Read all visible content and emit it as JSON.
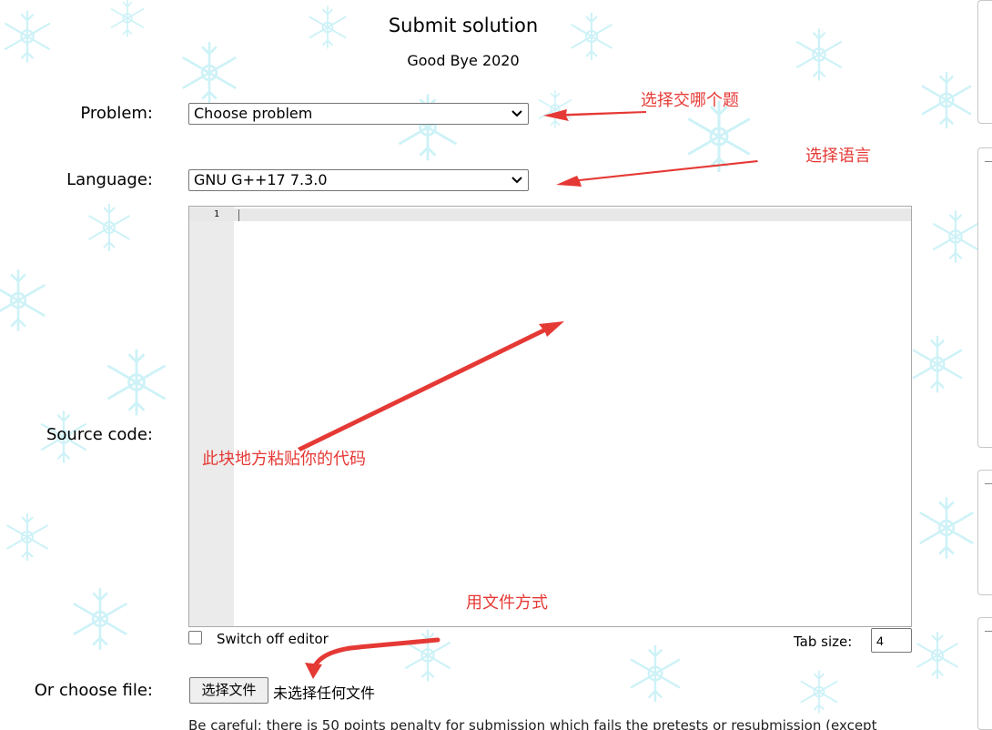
{
  "page": {
    "title": "Submit solution",
    "contest": "Good Bye 2020"
  },
  "form": {
    "problem_label": "Problem:",
    "problem_value": "Choose problem",
    "language_label": "Language:",
    "language_value": "GNU G++17 7.3.0",
    "source_label": "Source code:",
    "editor_line_number": "1",
    "switch_off_label": "Switch off editor",
    "tab_size_label": "Tab size:",
    "tab_size_value": "4",
    "file_label": "Or choose file:",
    "file_button_label": "选择文件",
    "file_status": "未选择任何文件",
    "warning_text": "Be careful: there is 50 points penalty for submission which fails the pretests or resubmission (except"
  },
  "annotations": {
    "problem_note": "选择交哪个题",
    "language_note": "选择语言",
    "code_note": "此块地方粘贴你的代码",
    "file_note": "用文件方式"
  },
  "colors": {
    "annotation": "#e53935",
    "snowflake": "#bfeff6",
    "gutter": "#ebebeb"
  },
  "icons": {
    "select_arrow": "chevron-down-icon",
    "background": "snowflake-icon"
  }
}
